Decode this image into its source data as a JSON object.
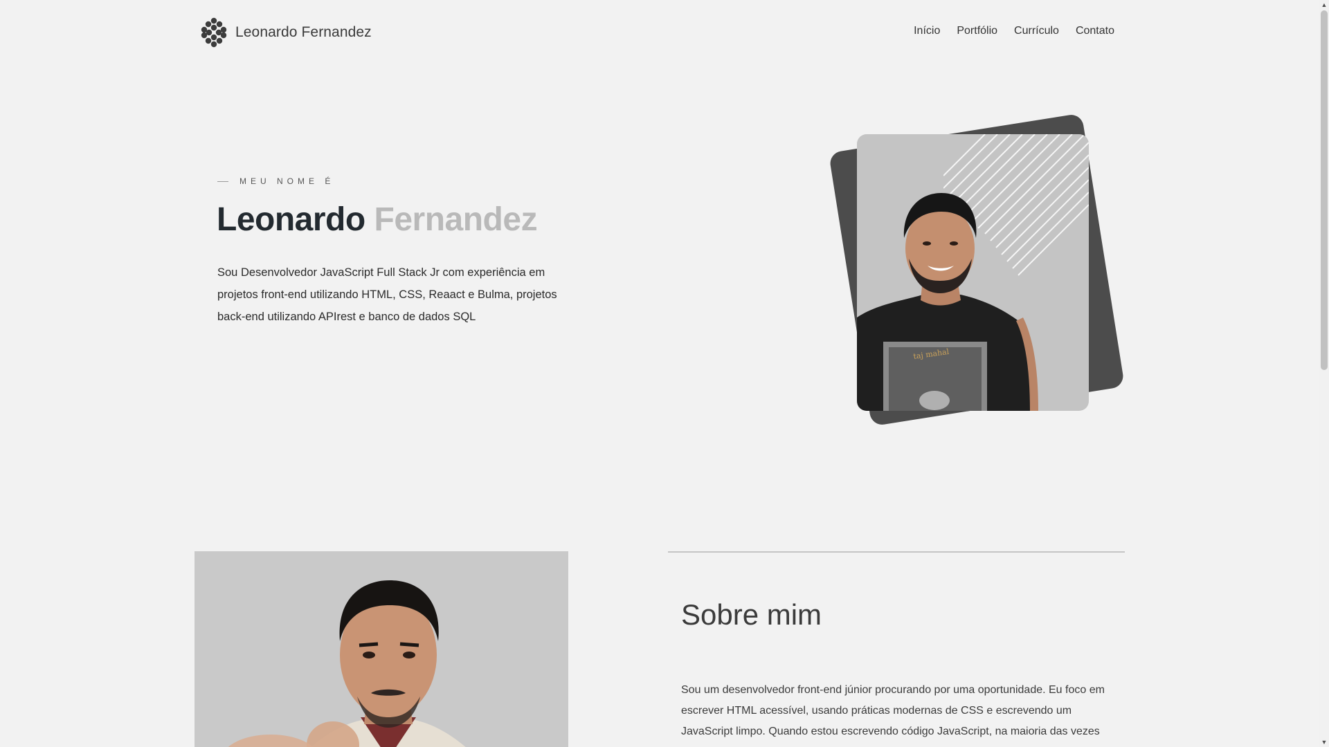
{
  "header": {
    "logo_text": "Leonardo Fernandez",
    "nav": [
      {
        "label": "Início"
      },
      {
        "label": "Portfólio"
      },
      {
        "label": "Currículo"
      },
      {
        "label": "Contato"
      }
    ]
  },
  "hero": {
    "eyebrow": "MEU NOME É",
    "first_name": "Leonardo",
    "last_name": "Fernandez",
    "description": "Sou Desenvolvedor JavaScript Full Stack Jr com experiência em projetos front-end utilizando HTML, CSS, Reaact e Bulma, projetos back-end utilizando APIrest e banco de dados SQL"
  },
  "about": {
    "title": "Sobre mim",
    "text": "Sou um desenvolvedor front-end júnior procurando por uma oportunidade. Eu foco em escrever HTML acessível, usando práticas modernas de CSS e escrevendo um JavaScript limpo. Quando estou escrevendo código JavaScript, na maioria das vezes estou usando"
  },
  "colors": {
    "background": "#f2f2f2",
    "name_dark": "#232a30",
    "name_light": "#b9b9b9",
    "card_back": "#4c4c4c",
    "card_front": "#c4c4c4"
  },
  "icons": {
    "logo": "molecule-logo-icon",
    "scroll_up": "arrow-up-icon",
    "scroll_down": "arrow-down-icon"
  }
}
